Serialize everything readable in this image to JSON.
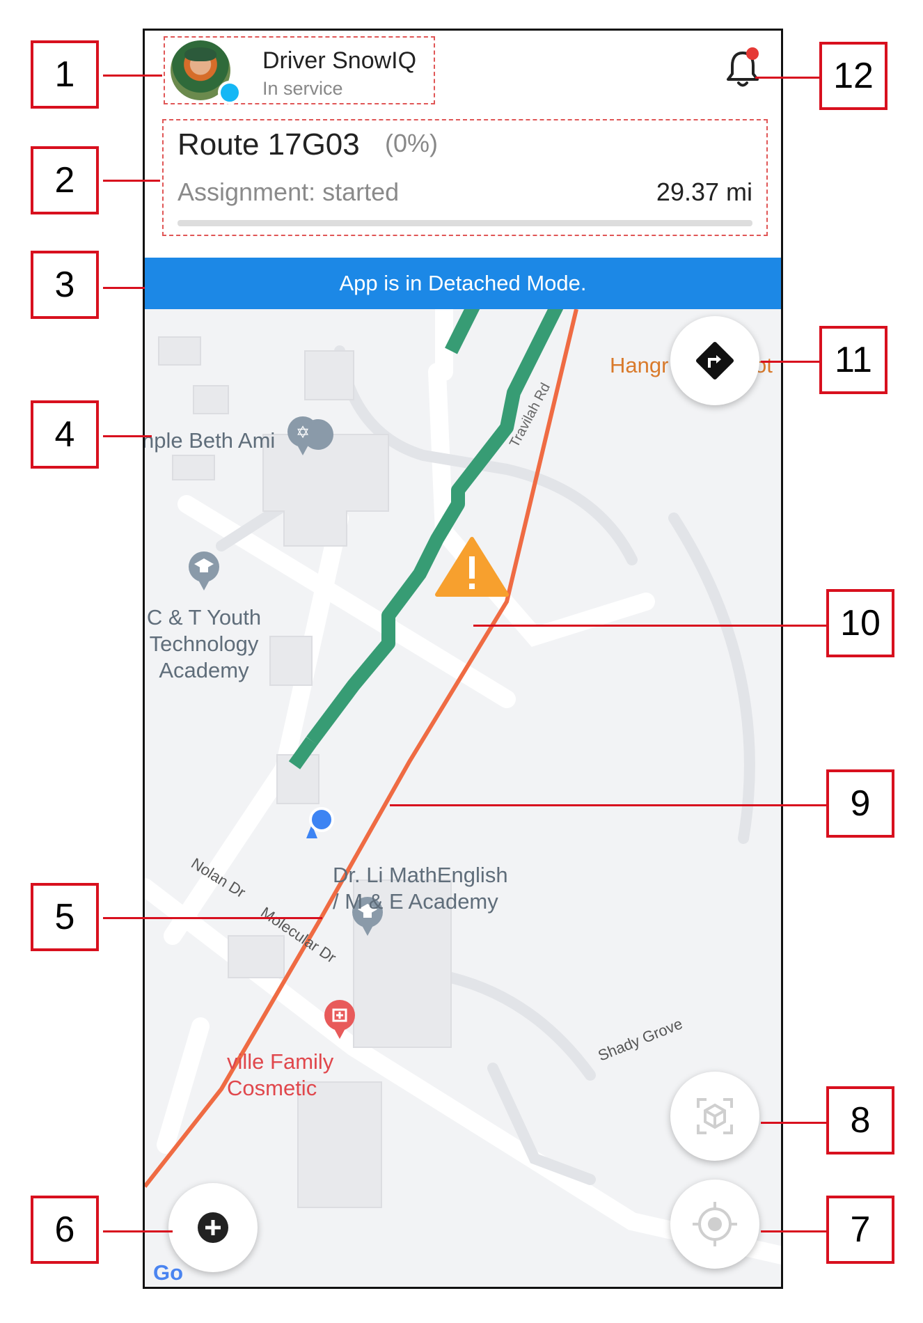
{
  "driver": {
    "name": "Driver SnowIQ",
    "status": "In service"
  },
  "route": {
    "title": "Route 17G03",
    "progress_label": "(0%)",
    "progress_fraction": 0.0,
    "assignment": "Assignment: started",
    "distance": "29.37 mi"
  },
  "banner": {
    "text": "App is in Detached Mode."
  },
  "map": {
    "places": {
      "temple": "nple Beth Ami",
      "youth_academy": "C & T Youth\nTechnology\nAcademy",
      "math_academy": "Dr. Li MathEnglish\n/ M & E Academy",
      "family": "ville Family\nCosmetic",
      "hangry": "Hangr",
      "hangry_tail": "ot"
    },
    "streets": {
      "travilah": "Travilah Rd",
      "nolan": "Nolan Dr",
      "molecular": "Molecular Dr",
      "shady_grove": "Shady Grove"
    },
    "attribution": "Go"
  },
  "colors": {
    "banner": "#1c88e6",
    "route_green": "#379c74",
    "path_orange": "#ef6b43",
    "warning": "#f7a02e",
    "location_blue": "#3d84f3",
    "callout_red": "#d8101e"
  },
  "icons": {
    "notification": "bell-icon",
    "directions": "directions-turn-icon",
    "add": "plus-circle-icon",
    "recenter": "my-location-icon",
    "ar": "cube-scan-icon",
    "warning": "warning-triangle-icon"
  },
  "callouts": [
    "1",
    "2",
    "3",
    "4",
    "5",
    "6",
    "7",
    "8",
    "9",
    "10",
    "11",
    "12"
  ]
}
